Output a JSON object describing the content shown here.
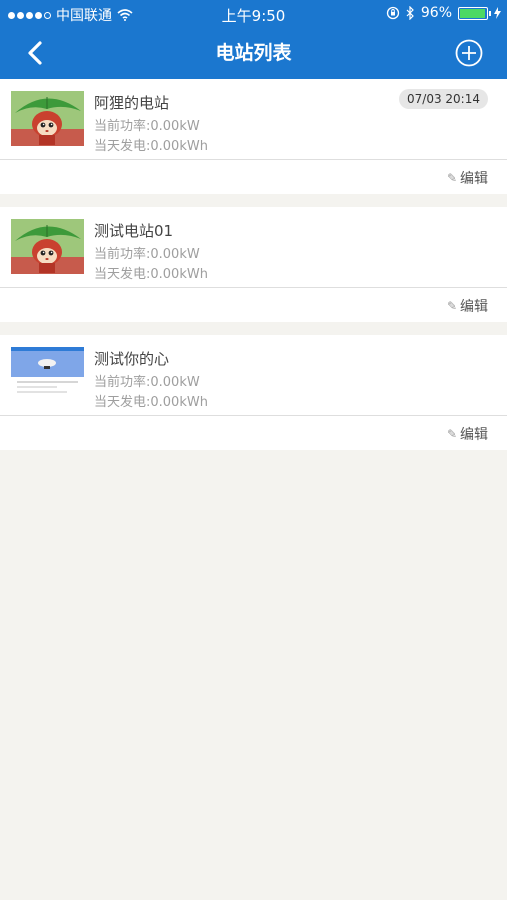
{
  "status_bar": {
    "carrier": "中国联通",
    "time": "上午9:50",
    "battery": "96%",
    "battery_level": 0.96
  },
  "nav": {
    "title": "电站列表"
  },
  "stations": [
    {
      "name": "阿狸的电站",
      "power": "当前功率:0.00kW",
      "energy": "当天发电:0.00kWh",
      "time": "07/03 20:14",
      "edit_label": "编辑",
      "thumb_icon": "ali-fox-thumbnail"
    },
    {
      "name": "测试电站01",
      "power": "当前功率:0.00kW",
      "energy": "当天发电:0.00kWh",
      "time": "",
      "edit_label": "编辑",
      "thumb_icon": "ali-fox-thumbnail"
    },
    {
      "name": "测试你的心",
      "power": "当前功率:0.00kW",
      "energy": "当天发电:0.00kWh",
      "time": "",
      "edit_label": "编辑",
      "thumb_icon": "webpage-screenshot-thumbnail"
    }
  ]
}
